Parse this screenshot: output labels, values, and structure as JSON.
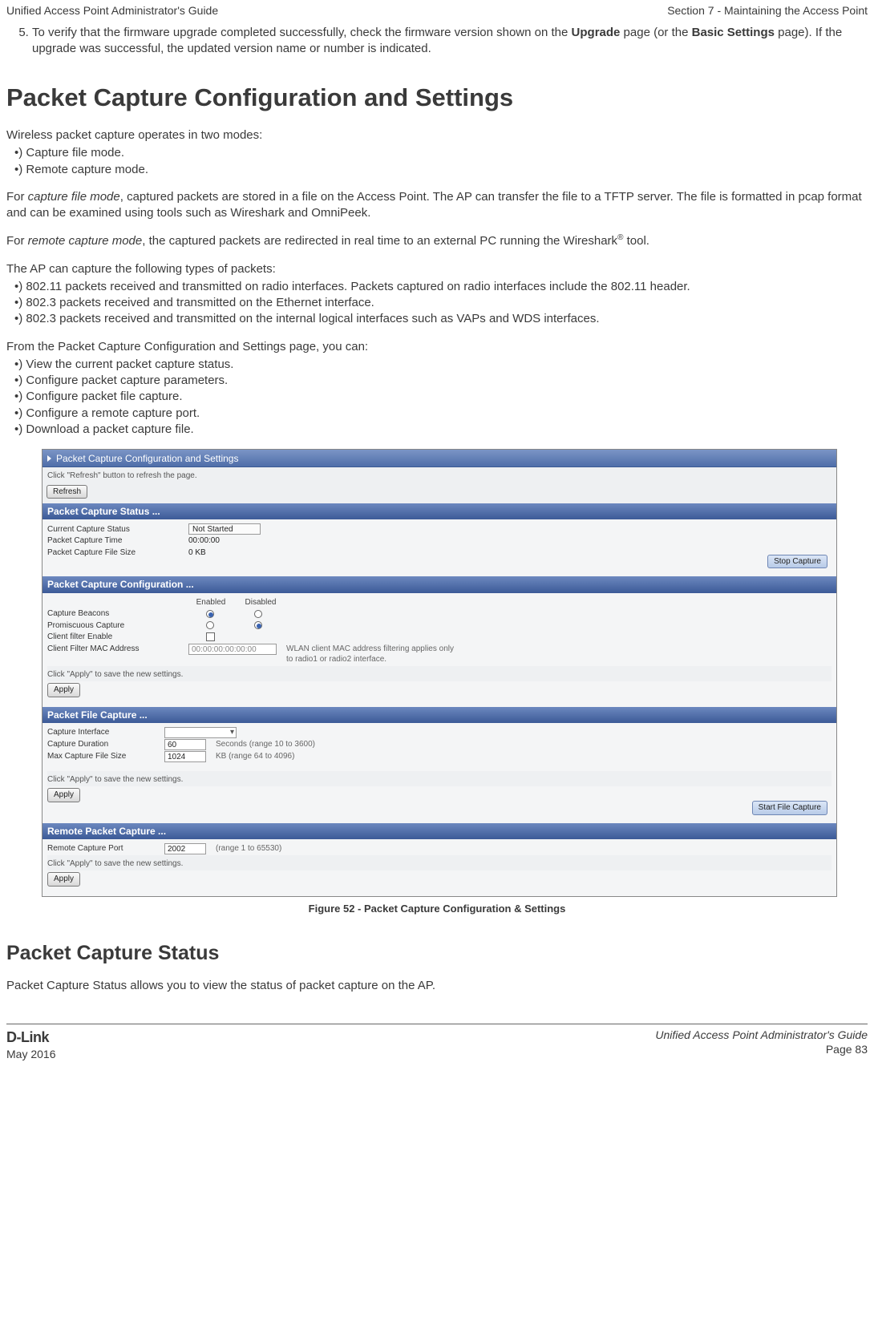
{
  "header": {
    "left": "Unified Access Point Administrator's Guide",
    "right": "Section 7 - Maintaining the Access Point"
  },
  "firmware_step": {
    "num": "5.)",
    "t1": "To verify that the firmware upgrade completed successfully, check the firmware version shown on the ",
    "b1": "Upgrade",
    "t2": " page (or the ",
    "b2": "Basic Settings",
    "t3": " page). If the upgrade was successful, the updated version name or number is indicated."
  },
  "h1": "Packet Capture Configuration and Settings",
  "intro1": "Wireless packet capture operates in two modes:",
  "modes": [
    "Capture file mode.",
    "Remote capture mode."
  ],
  "para1": {
    "p1": "For ",
    "i1": "capture file mode",
    "p2": ", captured packets are stored in a file on the Access Point. The AP can transfer the file to a TFTP server. The file is formatted in pcap format and can be examined using tools such as Wireshark and OmniPeek."
  },
  "para2": {
    "p1": "For ",
    "i1": "remote capture mode",
    "p2": ", the captured packets are redirected in real time to an external PC running the Wireshark",
    "sup": "®",
    "p3": " tool."
  },
  "intro2": "The AP can capture the following types of packets:",
  "pkts": [
    "802.11 packets received and transmitted on radio interfaces. Packets captured on radio interfaces include the 802.11 header.",
    "802.3 packets received and transmitted on the Ethernet interface.",
    "802.3 packets received and transmitted on the internal logical interfaces such as VAPs and WDS interfaces."
  ],
  "intro3": "From the Packet Capture Configuration and Settings page, you can:",
  "actions": [
    "View the current packet capture status.",
    "Configure packet capture parameters.",
    "Configure packet file capture.",
    "Configure a remote capture port.",
    "Download a packet capture file."
  ],
  "ui": {
    "title": "Packet Capture Configuration and Settings",
    "refresh_hint": "Click \"Refresh\" button to refresh the page.",
    "refresh_btn": "Refresh",
    "status": {
      "head": "Packet Capture Status ...",
      "rows": {
        "cur_label": "Current Capture Status",
        "cur_val": "Not Started",
        "time_label": "Packet Capture Time",
        "time_val": "00:00:00",
        "size_label": "Packet Capture File Size",
        "size_val": "0 KB"
      },
      "stop_btn": "Stop Capture"
    },
    "config": {
      "head": "Packet Capture Configuration ...",
      "col_en": "Enabled",
      "col_dis": "Disabled",
      "beacons": "Capture Beacons",
      "promisc": "Promiscuous Capture",
      "cfilter": "Client filter Enable",
      "mac_label": "Client Filter MAC Address",
      "mac_val": "00:00:00:00:00:00",
      "mac_note": "WLAN client MAC address filtering applies only to radio1 or radio2 interface.",
      "apply_hint": "Click \"Apply\" to save the new settings.",
      "apply_btn": "Apply"
    },
    "file": {
      "head": "Packet File Capture ...",
      "iface": "Capture Interface",
      "dur_label": "Capture Duration",
      "dur_val": "60",
      "dur_note": "Seconds (range 10 to 3600)",
      "max_label": "Max Capture File Size",
      "max_val": "1024",
      "max_note": "KB (range 64 to 4096)",
      "apply_hint": "Click \"Apply\" to save the new settings.",
      "apply_btn": "Apply",
      "start_btn": "Start File Capture"
    },
    "remote": {
      "head": "Remote Packet Capture ...",
      "port_label": "Remote Capture Port",
      "port_val": "2002",
      "port_note": "(range 1 to 65530)",
      "apply_hint": "Click \"Apply\" to save the new settings.",
      "apply_btn": "Apply"
    }
  },
  "figcap": "Figure 52 - Packet Capture Configuration & Settings",
  "h2": "Packet Capture Status",
  "status_text": "Packet Capture Status allows you to view the status of packet capture on the AP.",
  "footer": {
    "brand": "D-Link",
    "date": "May 2016",
    "r1": "Unified Access Point Administrator's Guide",
    "r2": "Page 83"
  }
}
